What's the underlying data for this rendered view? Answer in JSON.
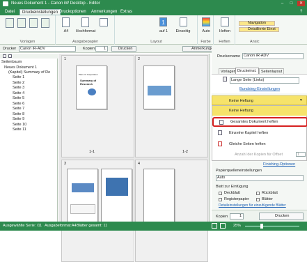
{
  "window": {
    "title": "Neues Dokument 1 - Canon iW Desktop - Editor",
    "min": "–",
    "max": "□",
    "close": "✕"
  },
  "menu": {
    "tabs": [
      "Datei",
      "Druckeinstellungen",
      "Druckoptionen",
      "Anmerkungen",
      "Extras"
    ],
    "help": "?"
  },
  "ribbon": {
    "groups": [
      "Vorlagen",
      "Ausgabepapier",
      "Layout",
      "Farbe",
      "Heften",
      "Ansic"
    ],
    "size": "A4",
    "orientation": "Hochformat",
    "layout_count": "1",
    "layout_sub": "auf 1",
    "sides": "Einseitig",
    "color": "Auto",
    "staple": "Heften",
    "view_nav": "Navigation",
    "view_detail": "Detaillierte Einst"
  },
  "toolbar": {
    "printer_label": "Drucker",
    "printer_value": "Canon iR-ADV",
    "copies_label": "Kopien",
    "copies_value": "1",
    "print_button": "Drucken",
    "annotations_button": "Anmerkungen ans."
  },
  "tree": {
    "header": "Seitenbaum",
    "root": "Neues Dokument 1",
    "chapter": "(Kapitel) Summary of Re",
    "pages": [
      "Seite 1",
      "Seite 2",
      "Seite 3",
      "Seite 4",
      "Seite 5",
      "Seite 6",
      "Seite 7",
      "Seite 8",
      "Seite 9",
      "Seite 10",
      "Seite 11"
    ]
  },
  "pages": {
    "cells": [
      {
        "number": "1",
        "label1": "1-1",
        "label2": "1-2"
      },
      {
        "number": "2",
        "label1": "",
        "label2": ""
      },
      {
        "number": "3",
        "label1": "",
        "label2": ""
      },
      {
        "number": "4",
        "label1": "",
        "label2": ""
      }
    ],
    "page1_title": "Summary of Research",
    "page1_sub": "Plan 2.0 Corporation"
  },
  "settings": {
    "printer_name_label": "Druckername",
    "printer_name_value": "Canon iR-ADV",
    "tabs": [
      "Vorlagen",
      "Druckeinst.",
      "Seitenlayout"
    ],
    "binding_value": "Lange Seite (Links)",
    "binding_link": "Bundsteg-Einstellungen",
    "staple_selected": "Keine Heftung",
    "dropdown_items": [
      "Keine Heftung",
      "Gesamtes Dokument heften",
      "Einzelne Kapitel heften",
      "Gleiche Seiten heften"
    ],
    "offset_label": "Anzahl der Kopien für Offset",
    "offset_value": "1",
    "finishing_link": "Finishing-Optionen",
    "paper_source_label": "Papierquelleneinstellungen",
    "paper_source_value": "Auto",
    "insert_label": "Blatt zur Einfügung",
    "opt_deckblatt": "Deckblatt",
    "opt_rueckblatt": "Rückblatt",
    "opt_register": "Registerpapier",
    "opt_blaetter": "Blätter",
    "detail_link": "Detaileinstellungen für einzufügende Blätter",
    "copies_label": "Kopien",
    "copies_value": "1",
    "print_button": "Drucken"
  },
  "status": {
    "series": "Ausgewählte Serie: /11",
    "format": "Ausgabeformat:A4",
    "sheets": "Blätter gesamt: 11",
    "zoom": "25%"
  },
  "colors": {
    "accent": "#2d8a4e",
    "highlight": "#f6e36a",
    "selection_border": "#d62020"
  }
}
